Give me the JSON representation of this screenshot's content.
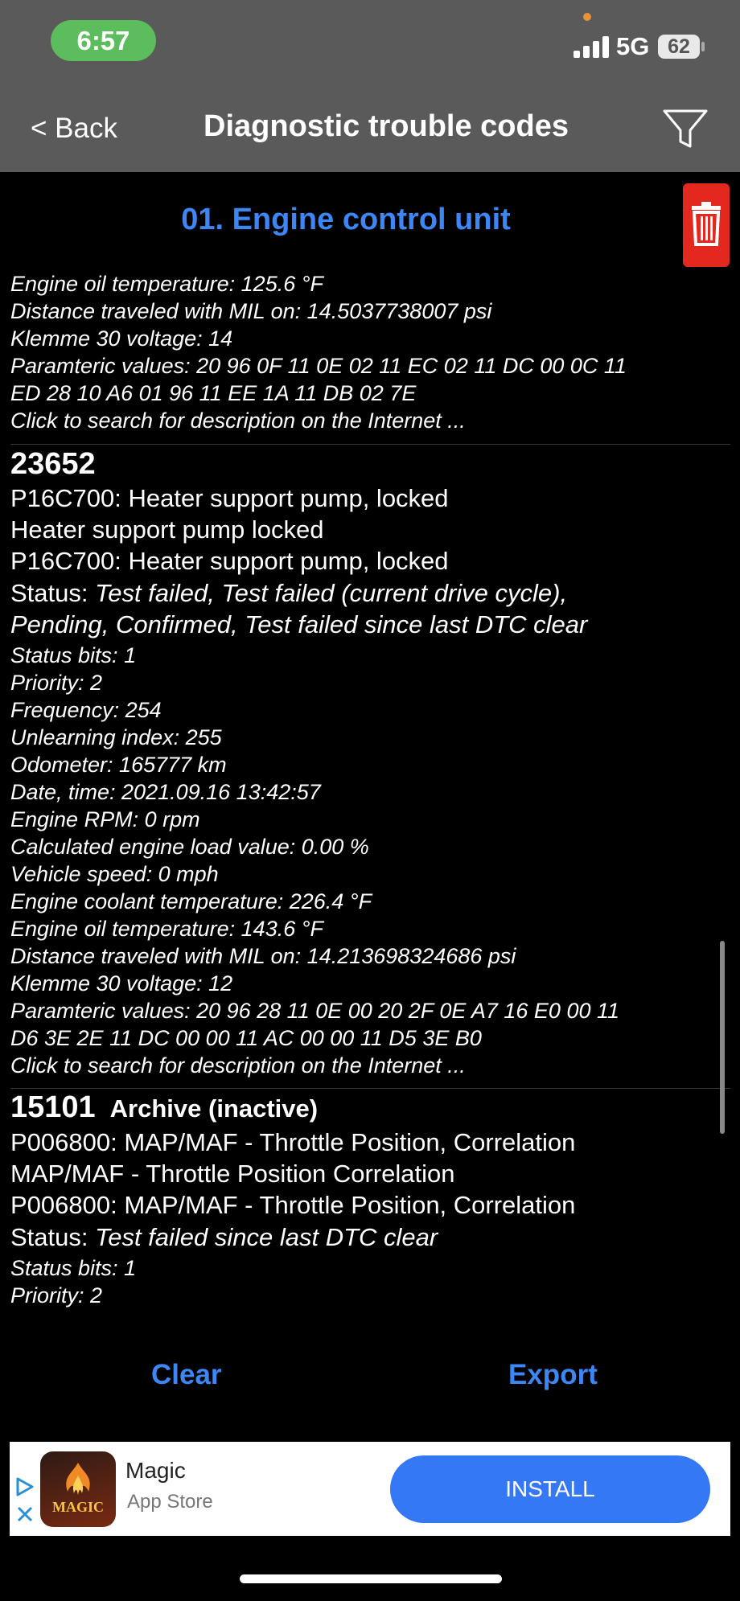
{
  "status_bar": {
    "time": "6:57",
    "network": "5G",
    "battery": "62"
  },
  "nav": {
    "back_label": "< Back",
    "title": "Diagnostic trouble codes"
  },
  "section_title": "01. Engine control unit",
  "entry_prev": {
    "lines": [
      "Engine oil temperature: 125.6 °F",
      "Distance traveled with MIL on: 14.5037738007 psi",
      "Klemme 30 voltage: 14",
      "Paramteric values:  20 96 0F 11 0E 02 11 EC 02 11 DC 00 0C 11",
      "ED 28 10 A6 01 96 11 EE 1A 11 DB 02 7E",
      "Click to search for description on the Internet ..."
    ]
  },
  "entry_1": {
    "code": "23652",
    "line1": "P16C700: Heater support pump, locked",
    "line2": "Heater support pump locked",
    "line3": "P16C700: Heater support pump, locked",
    "status_label": "Status: ",
    "status_value_1": "Test failed, Test failed (current drive cycle),",
    "status_value_2": "Pending, Confirmed, Test failed since last DTC clear",
    "details": [
      "Status bits: 1",
      "Priority: 2",
      "Frequency: 254",
      "Unlearning index: 255",
      "Odometer: 165777 km",
      "Date, time: 2021.09.16 13:42:57",
      "Engine RPM: 0 rpm",
      "Calculated engine load value: 0.00 %",
      "Vehicle speed: 0 mph",
      "Engine coolant temperature: 226.4 °F",
      "Engine oil temperature: 143.6 °F",
      "Distance traveled with MIL on: 14.213698324686 psi",
      "Klemme 30 voltage: 12",
      "Paramteric values:  20 96 28 11 0E 00 20 2F 0E A7 16 E0 00 11",
      "D6 3E 2E 11 DC 00 00 11 AC 00 00 11 D5 3E B0",
      "Click to search for description on the Internet ..."
    ]
  },
  "entry_2": {
    "code": "15101",
    "archive": "Archive (inactive)",
    "line1": "P006800: MAP/MAF - Throttle Position, Correlation",
    "line2": "MAP/MAF - Throttle Position Correlation",
    "line3": "P006800: MAP/MAF - Throttle Position, Correlation",
    "status_label": "Status: ",
    "status_value": "Test failed since last DTC clear",
    "details": [
      "Status bits: 1",
      "Priority: 2"
    ]
  },
  "actions": {
    "clear_label": "Clear",
    "export_label": "Export"
  },
  "ad": {
    "app_name": "Magic",
    "store": "App Store",
    "install_label": "INSTALL",
    "icon_text": "MAGIC"
  },
  "colors": {
    "accent": "#3d86f5",
    "delete": "#e2281f",
    "install": "#3478f6",
    "time_pill": "#5bbd5b"
  }
}
